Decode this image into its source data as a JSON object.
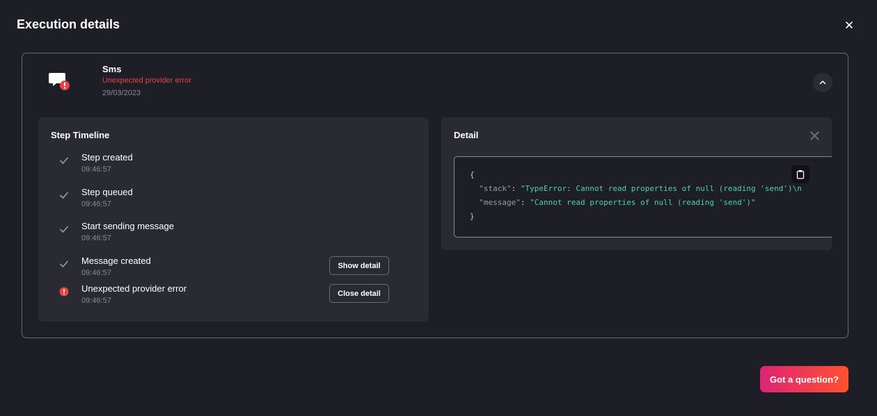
{
  "modal": {
    "title": "Execution details",
    "close_icon": "close-icon"
  },
  "channel": {
    "icon": "chat-bubble-icon",
    "badge_icon": "error-badge-icon",
    "name": "Sms",
    "error": "Unexpected provider error",
    "date": "29/03/2023",
    "toggle_icon": "chevron-up-icon"
  },
  "timeline": {
    "title": "Step Timeline",
    "steps": [
      {
        "label": "Step created",
        "time": "09:46:57",
        "status": "success",
        "icon": "check-icon"
      },
      {
        "label": "Step queued",
        "time": "09:46:57",
        "status": "success",
        "icon": "check-icon"
      },
      {
        "label": "Start sending message",
        "time": "09:46:57",
        "status": "success",
        "icon": "check-icon"
      },
      {
        "label": "Message created",
        "time": "09:46:57",
        "status": "success",
        "icon": "check-icon",
        "action": "Show detail"
      },
      {
        "label": "Unexpected provider error",
        "time": "09:46:57",
        "status": "error",
        "icon": "error-icon",
        "action": "Close detail"
      }
    ]
  },
  "detail": {
    "title": "Detail",
    "close_icon": "close-icon",
    "copy_icon": "clipboard-icon",
    "code": {
      "open": "{",
      "line1_key": "\"stack\"",
      "line1_value": "\"TypeError: Cannot read properties of null (reading 'send')\\n    at",
      "line2_key": "\"message\"",
      "line2_value": "\"Cannot read properties of null (reading 'send')\"",
      "close": "}"
    }
  },
  "help_button": "Got a question?",
  "colors": {
    "background": "#1e1e26",
    "panel": "#2a2a33",
    "error": "#e54545",
    "json_string": "#4fd1a5",
    "gradient_start": "#dd2476",
    "gradient_end": "#ff512f"
  }
}
